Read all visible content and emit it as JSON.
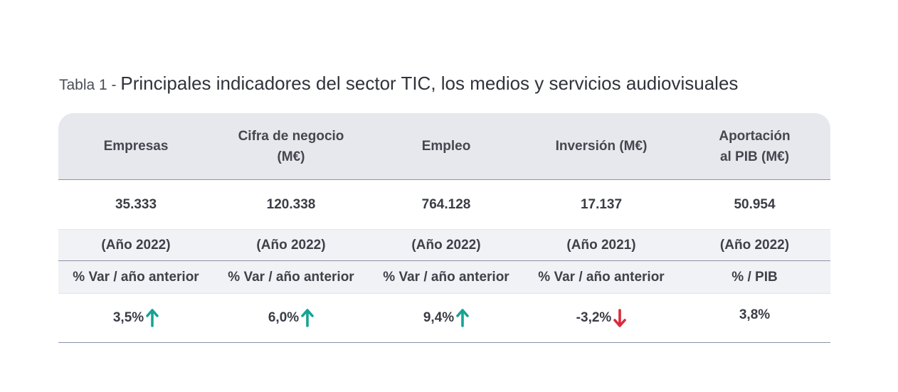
{
  "title": {
    "prefix": "Tabla 1 - ",
    "main": "Principales indicadores del sector TIC, los medios y servicios audiovisuales"
  },
  "table": {
    "headers": [
      {
        "line1": "Empresas",
        "line2": ""
      },
      {
        "line1": "Cifra de negocio",
        "line2": "(M€)"
      },
      {
        "line1": "Empleo",
        "line2": ""
      },
      {
        "line1": "Inversión (M€)",
        "line2": ""
      },
      {
        "line1": "Aportación",
        "line2": "al PIB (M€)"
      }
    ],
    "values": [
      "35.333",
      "120.338",
      "764.128",
      "17.137",
      "50.954"
    ],
    "years": [
      "(Año 2022)",
      "(Año 2022)",
      "(Año 2022)",
      "(Año 2021)",
      "(Año 2022)"
    ],
    "var_labels": [
      "% Var / año anterior",
      "% Var / año anterior",
      "% Var / año anterior",
      "% Var / año anterior",
      "% / PIB"
    ],
    "pcts": [
      {
        "value": "3,5%",
        "trend": "up-arrow-icon"
      },
      {
        "value": "6,0%",
        "trend": "up-arrow-icon"
      },
      {
        "value": "9,4%",
        "trend": "up-arrow-icon"
      },
      {
        "value": "-3,2%",
        "trend": "down-arrow-icon"
      },
      {
        "value": "3,8%",
        "trend": ""
      }
    ]
  },
  "colors": {
    "up": "#16a394",
    "down": "#d92b3a",
    "header_bg": "#e7e8ed",
    "band_bg": "#f1f2f6",
    "rule": "#8c93a8"
  }
}
